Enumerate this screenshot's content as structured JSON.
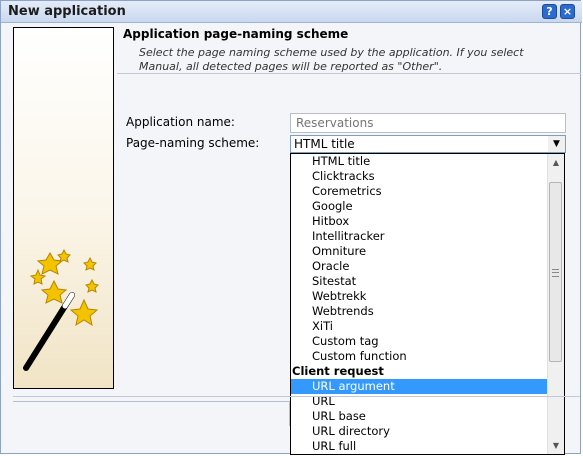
{
  "window": {
    "title": "New application",
    "help_label": "?",
    "close_label": "×"
  },
  "header": {
    "title": "Application page-naming scheme",
    "description_line1": "Select the page naming scheme used by the application. If you select",
    "description_line2": "Manual, all detected pages will be reported as \"Other\"."
  },
  "form": {
    "app_name_label": "Application name:",
    "app_name_placeholder": "Reservations",
    "scheme_label": "Page-naming scheme:",
    "scheme_value": "HTML title"
  },
  "dropdown": {
    "options_group1": [
      "HTML title",
      "Clicktracks",
      "Coremetrics",
      "Google",
      "Hitbox",
      "Intellitracker",
      "Omniture",
      "Oracle",
      "Sitestat",
      "Webtrekk",
      "Webtrends",
      "XiTi",
      "Custom tag",
      "Custom function"
    ],
    "group2_label": "Client request",
    "options_group2": [
      "URL argument",
      "URL",
      "URL base",
      "URL directory",
      "URL full"
    ],
    "selected": "URL argument"
  },
  "colors": {
    "selection": "#3399ff",
    "titlebar": "#c9d8ef"
  },
  "icons": {
    "wizard": "magic-wand-stars-icon",
    "help": "help-icon",
    "close": "close-icon"
  }
}
